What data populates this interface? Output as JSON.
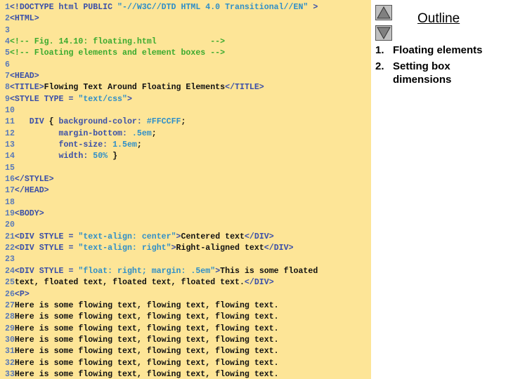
{
  "code_lines": [
    {
      "n": "1",
      "segs": [
        [
          "t",
          "<!DOCTYPE html PUBLIC "
        ],
        [
          "s",
          "\"-//W3C//DTD HTML 4.0 Transitional//EN\""
        ],
        [
          "t",
          " >"
        ]
      ]
    },
    {
      "n": "2",
      "segs": [
        [
          "t",
          "<HTML>"
        ]
      ]
    },
    {
      "n": "3",
      "segs": []
    },
    {
      "n": "4",
      "segs": [
        [
          "c",
          "<!-- Fig. 14.10: floating.html           -->"
        ]
      ]
    },
    {
      "n": "5",
      "segs": [
        [
          "c",
          "<!-- Floating elements and element boxes -->"
        ]
      ]
    },
    {
      "n": "6",
      "segs": []
    },
    {
      "n": "7",
      "segs": [
        [
          "t",
          "<HEAD>"
        ]
      ]
    },
    {
      "n": "8",
      "segs": [
        [
          "t",
          "<TITLE>"
        ],
        [
          "x",
          "Flowing Text Around Floating Elements"
        ],
        [
          "t",
          "</TITLE>"
        ]
      ]
    },
    {
      "n": "9",
      "segs": [
        [
          "t",
          "<STYLE TYPE = "
        ],
        [
          "s",
          "\"text/css\""
        ],
        [
          "t",
          ">"
        ]
      ]
    },
    {
      "n": "10",
      "segs": []
    },
    {
      "n": "11",
      "segs": [
        [
          "t",
          "   DIV "
        ],
        [
          "x",
          "{ "
        ],
        [
          "t",
          "background-color: "
        ],
        [
          "s",
          "#FFCCFF"
        ],
        [
          "x",
          ";"
        ]
      ]
    },
    {
      "n": "12",
      "segs": [
        [
          "t",
          "         margin-bottom: "
        ],
        [
          "s",
          ".5em"
        ],
        [
          "x",
          ";"
        ]
      ]
    },
    {
      "n": "13",
      "segs": [
        [
          "t",
          "         font-size: "
        ],
        [
          "s",
          "1.5em"
        ],
        [
          "x",
          ";"
        ]
      ]
    },
    {
      "n": "14",
      "segs": [
        [
          "t",
          "         width: "
        ],
        [
          "s",
          "50%"
        ],
        [
          "x",
          " }"
        ]
      ]
    },
    {
      "n": "15",
      "segs": []
    },
    {
      "n": "16",
      "segs": [
        [
          "t",
          "</STYLE>"
        ]
      ]
    },
    {
      "n": "17",
      "segs": [
        [
          "t",
          "</HEAD>"
        ]
      ]
    },
    {
      "n": "18",
      "segs": []
    },
    {
      "n": "19",
      "segs": [
        [
          "t",
          "<BODY>"
        ]
      ]
    },
    {
      "n": "20",
      "segs": []
    },
    {
      "n": "21",
      "segs": [
        [
          "t",
          "<DIV STYLE = "
        ],
        [
          "s",
          "\"text-align: center\""
        ],
        [
          "t",
          ">"
        ],
        [
          "x",
          "Centered text"
        ],
        [
          "t",
          "</DIV>"
        ]
      ]
    },
    {
      "n": "22",
      "segs": [
        [
          "t",
          "<DIV STYLE = "
        ],
        [
          "s",
          "\"text-align: right\""
        ],
        [
          "t",
          ">"
        ],
        [
          "x",
          "Right-aligned text"
        ],
        [
          "t",
          "</DIV>"
        ]
      ]
    },
    {
      "n": "23",
      "segs": []
    },
    {
      "n": "24",
      "segs": [
        [
          "t",
          "<DIV STYLE = "
        ],
        [
          "s",
          "\"float: right; margin: .5em\""
        ],
        [
          "t",
          ">"
        ],
        [
          "x",
          "This is some floated"
        ]
      ]
    },
    {
      "n": "25",
      "segs": [
        [
          "x",
          "text, floated text, floated text, floated text."
        ],
        [
          "t",
          "</DIV>"
        ]
      ]
    },
    {
      "n": "26",
      "segs": [
        [
          "t",
          "<P>"
        ]
      ]
    },
    {
      "n": "27",
      "segs": [
        [
          "x",
          "Here is some flowing text, flowing text, flowing text."
        ]
      ]
    },
    {
      "n": "28",
      "segs": [
        [
          "x",
          "Here is some flowing text, flowing text, flowing text."
        ]
      ]
    },
    {
      "n": "29",
      "segs": [
        [
          "x",
          "Here is some flowing text, flowing text, flowing text."
        ]
      ]
    },
    {
      "n": "30",
      "segs": [
        [
          "x",
          "Here is some flowing text, flowing text, flowing text."
        ]
      ]
    },
    {
      "n": "31",
      "segs": [
        [
          "x",
          "Here is some flowing text, flowing text, flowing text."
        ]
      ]
    },
    {
      "n": "32",
      "segs": [
        [
          "x",
          "Here is some flowing text, flowing text, flowing text."
        ]
      ]
    },
    {
      "n": "33",
      "segs": [
        [
          "x",
          "Here is some flowing text, flowing text, flowing text."
        ]
      ]
    }
  ],
  "sidebar": {
    "title": "Outline",
    "items": [
      {
        "num": "1.",
        "label": "Floating elements"
      },
      {
        "num": "2.",
        "label": "Setting box dimensions"
      }
    ],
    "icons": {
      "up": "triangle-up-icon",
      "down": "triangle-down-icon"
    }
  },
  "colors": {
    "code_bg": "#fde597",
    "tag": "#3a4fa8",
    "string": "#2f8fc8",
    "comment": "#3aaa2e",
    "text": "#111111"
  }
}
